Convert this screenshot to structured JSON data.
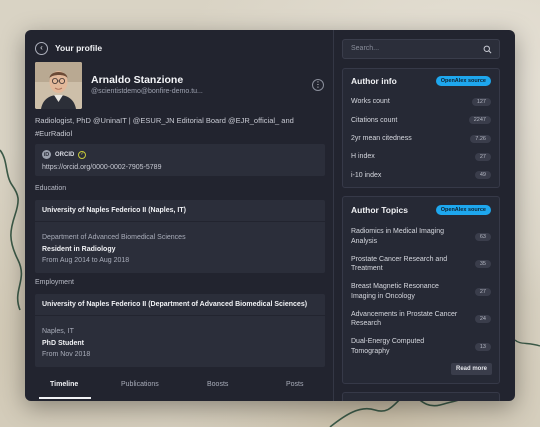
{
  "header": {
    "back_icon": "chevron-left-icon",
    "title": "Your profile"
  },
  "profile": {
    "name": "Arnaldo Stanzione",
    "handle": "@scientistdemo@bonfire-demo.tu...",
    "bio": "Radiologist, PhD @UninaIT | @ESUR_JN Editorial Board @EJR_official_ and #EurRadiol",
    "more_icon": "more-vertical-icon"
  },
  "orcid": {
    "label": "ORCID",
    "url": "https://orcid.org/0000-0002-7905-5789",
    "verified_icon": "check-circle-icon"
  },
  "education": {
    "section_label": "Education",
    "institution": "University of Naples Federico II (Naples, IT)",
    "department": "Department of Advanced Biomedical Sciences",
    "role": "Resident in Radiology",
    "dates": "From Aug 2014 to Aug 2018"
  },
  "employment": {
    "section_label": "Employment",
    "institution": "University of Naples Federico II (Department of Advanced Biomedical Sciences)",
    "location": "Naples, IT",
    "role": "PhD Student",
    "dates": "From Nov 2018"
  },
  "tabs": [
    {
      "label": "Timeline",
      "active": true
    },
    {
      "label": "Publications",
      "active": false
    },
    {
      "label": "Boosts",
      "active": false
    },
    {
      "label": "Posts",
      "active": false
    }
  ],
  "search": {
    "placeholder": "Search...",
    "icon": "search-icon"
  },
  "author_info": {
    "title": "Author info",
    "badge": "OpenAlex source",
    "rows": [
      {
        "label": "Works count",
        "value": "127"
      },
      {
        "label": "Citations count",
        "value": "2247"
      },
      {
        "label": "2yr mean citedness",
        "value": "7.26"
      },
      {
        "label": "H index",
        "value": "27"
      },
      {
        "label": "i-10 index",
        "value": "49"
      }
    ]
  },
  "author_topics": {
    "title": "Author Topics",
    "badge": "OpenAlex source",
    "rows": [
      {
        "label": "Radiomics in Medical Imaging Analysis",
        "value": "63"
      },
      {
        "label": "Prostate Cancer Research and Treatment",
        "value": "35"
      },
      {
        "label": "Breast Magnetic Resonance Imaging in Oncology",
        "value": "27"
      },
      {
        "label": "Advancements in Prostate Cancer Research",
        "value": "24"
      },
      {
        "label": "Dual-Energy Computed Tomography",
        "value": "13"
      }
    ],
    "read_more": "Read more"
  },
  "colors": {
    "background": "#22242f",
    "card": "#2b2e3a",
    "badge": "#1ea7ee",
    "verified": "#c6c93a"
  }
}
